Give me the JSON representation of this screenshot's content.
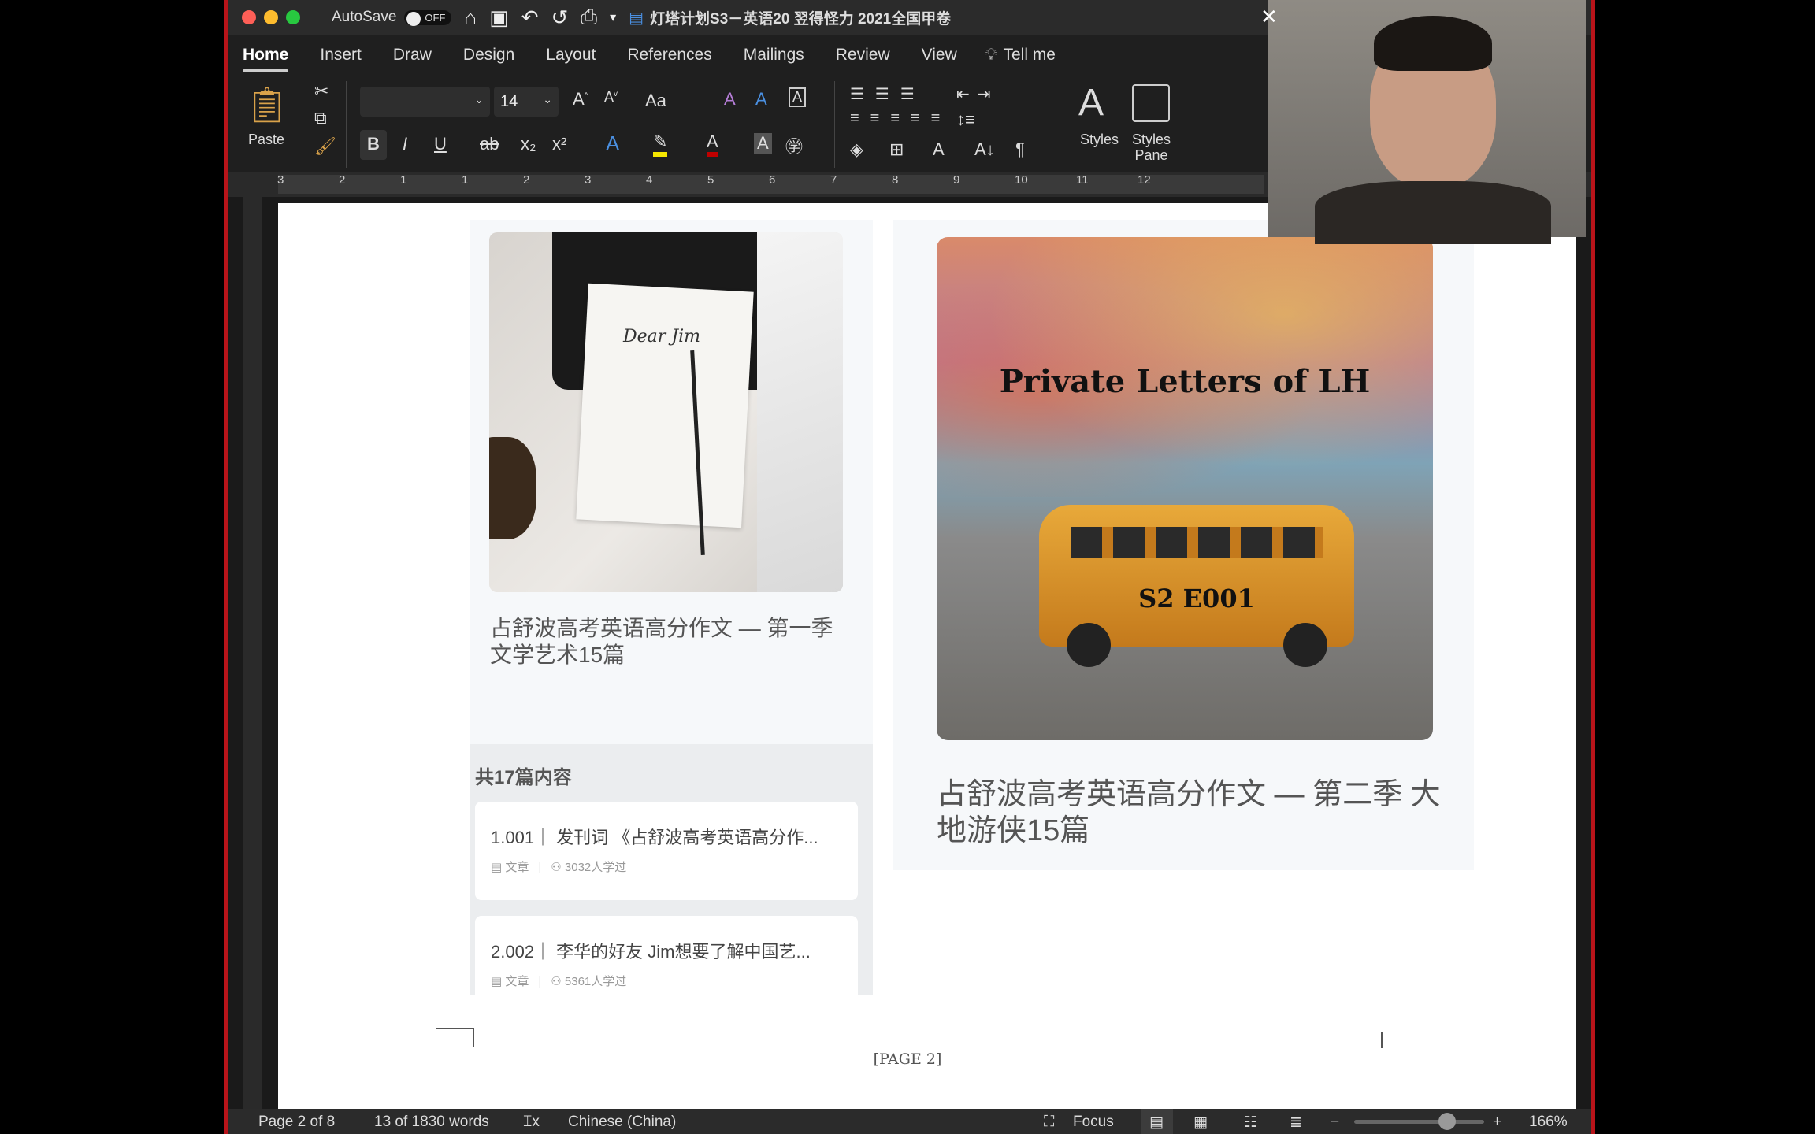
{
  "window": {
    "autosave_label": "AutoSave",
    "autosave_state": "OFF",
    "title": "灯塔计划S3－英语20 翌得怪力 2021全国甲卷"
  },
  "tabs": [
    {
      "label": "Home",
      "active": true
    },
    {
      "label": "Insert"
    },
    {
      "label": "Draw"
    },
    {
      "label": "Design"
    },
    {
      "label": "Layout"
    },
    {
      "label": "References"
    },
    {
      "label": "Mailings"
    },
    {
      "label": "Review"
    },
    {
      "label": "View"
    },
    {
      "label": "Tell me"
    }
  ],
  "ribbon": {
    "paste": "Paste",
    "font_name": "",
    "font_size": "14",
    "styles": "Styles",
    "styles_pane_1": "Styles",
    "styles_pane_2": "Pane",
    "bold": "B",
    "italic": "I",
    "underline": "U",
    "strike": "ab",
    "change_case": "Aa",
    "highlight_color": "#f5e600",
    "font_color": "#c00000"
  },
  "ruler": {
    "ticks": [
      "3",
      "2",
      "1",
      "1",
      "2",
      "3",
      "4",
      "5",
      "6",
      "7",
      "8",
      "9",
      "10",
      "11",
      "12"
    ]
  },
  "document": {
    "left_card": {
      "title": "占舒波高考英语高分作文 — 第一季 文学艺术15篇",
      "image_text": "Dear Jim",
      "count": "共17篇内容",
      "items": [
        {
          "title": "1.001｜ 发刊词 《占舒波高考英语高分作...",
          "type": "文章",
          "learners": "3032人学过"
        },
        {
          "title": "2.002｜ 李华的好友 Jim想要了解中国艺...",
          "type": "文章",
          "learners": "5361人学过"
        }
      ]
    },
    "right_card": {
      "image_title": "Private Letters of LH",
      "image_badge": "S2 E001",
      "title": "占舒波高考英语高分作文 — 第二季 大地游侠15篇"
    },
    "footer": "[PAGE 2]"
  },
  "status": {
    "page": "Page 2 of 8",
    "words": "13 of 1830 words",
    "language": "Chinese (China)",
    "focus": "Focus",
    "zoom": "166%",
    "zoom_level": 166
  }
}
